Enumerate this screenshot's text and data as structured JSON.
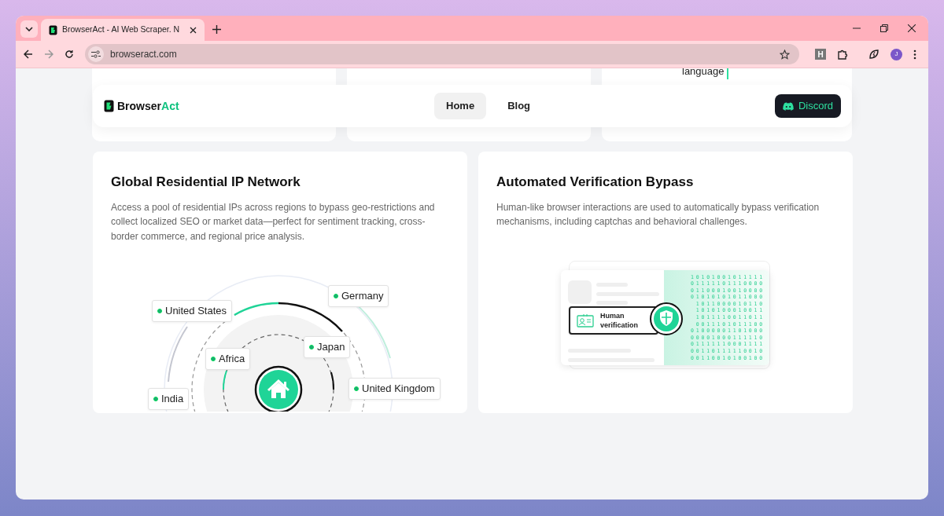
{
  "browser": {
    "tab_title": "BrowserAct - AI Web Scraper. N",
    "url": "browseract.com",
    "profile_initial": "J",
    "extension_letter": "H"
  },
  "top_cards": [
    {
      "kind": "blank"
    },
    {
      "kind": "blank"
    },
    {
      "kind": "text",
      "snippet": "language"
    }
  ],
  "nav": {
    "brand_prefix": "Browser",
    "brand_suffix": "Act",
    "links": [
      {
        "label": "Home",
        "selected": true
      },
      {
        "label": "Blog",
        "selected": false
      }
    ],
    "cta": "Discord"
  },
  "features": [
    {
      "kind": "network",
      "title": "Global Residential IP Network",
      "text": "Access a pool of residential IPs across regions to bypass geo-restrictions and collect localized SEO or market data—perfect for sentiment tracking, cross-border commerce, and regional price analysis.",
      "regions": [
        "United States",
        "Germany",
        "Africa",
        "Japan",
        "United Kingdom",
        "India"
      ]
    },
    {
      "kind": "verification",
      "title": "Automated Verification Bypass",
      "text": "Human-like browser interactions are used to automatically bypass verification mechanisms, including captchas and behavioral challenges.",
      "badge": "Human verification",
      "binary": [
        "10101001011111",
        "01111101110000",
        "01100010010000",
        "01010101011000",
        "1011000010110",
        "1010100010011",
        "1011110011011",
        "0011101011100",
        "01000001101000",
        "00001000111110",
        "01111110001111",
        "00110111110010",
        "00110010100100"
      ]
    }
  ]
}
